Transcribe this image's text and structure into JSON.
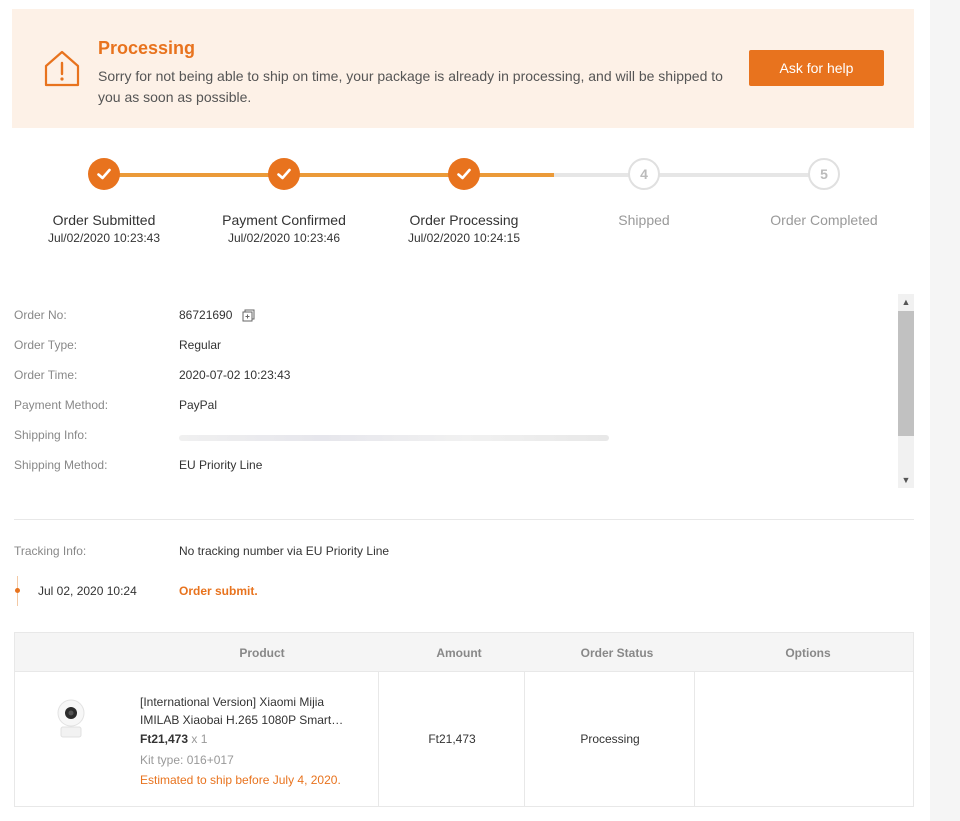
{
  "banner": {
    "title": "Processing",
    "message": "Sorry for not being able to ship on time, your package is already in processing, and will be shipped to you as soon as possible.",
    "help_button": "Ask for help",
    "icon": "warning-house-icon"
  },
  "steps": [
    {
      "label": "Order Submitted",
      "time": "Jul/02/2020 10:23:43",
      "state": "done"
    },
    {
      "label": "Payment Confirmed",
      "time": "Jul/02/2020 10:23:46",
      "state": "done"
    },
    {
      "label": "Order Processing",
      "time": "Jul/02/2020 10:24:15",
      "state": "done"
    },
    {
      "label": "Shipped",
      "number": "4",
      "state": "todo"
    },
    {
      "label": "Order Completed",
      "number": "5",
      "state": "todo"
    }
  ],
  "order_info": {
    "order_no_label": "Order No:",
    "order_no": "86721690",
    "order_type_label": "Order Type:",
    "order_type": "Regular",
    "order_time_label": "Order Time:",
    "order_time": "2020-07-02 10:23:43",
    "payment_method_label": "Payment Method:",
    "payment_method": "PayPal",
    "shipping_info_label": "Shipping Info:",
    "shipping_method_label": "Shipping Method:",
    "shipping_method": "EU Priority Line"
  },
  "tracking": {
    "label": "Tracking Info:",
    "value": "No tracking number via EU Priority Line",
    "events": [
      {
        "time": "Jul 02, 2020 10:24",
        "event": "Order submit."
      }
    ]
  },
  "product_table": {
    "headers": [
      "Product",
      "Amount",
      "Order Status",
      "Options"
    ],
    "rows": [
      {
        "name": "[International Version] Xiaomi Mijia IMILAB Xiaobai H.265 1080P Smart…",
        "price": "Ft21,473",
        "qty": "x 1",
        "kit_type": "Kit type: 016+017",
        "ship_estimate": "Estimated to ship before July 4, 2020.",
        "amount": "Ft21,473",
        "status": "Processing"
      }
    ]
  },
  "colors": {
    "accent": "#e8731e",
    "progress": "#eb9a39",
    "banner_bg": "#fdf1e7"
  }
}
